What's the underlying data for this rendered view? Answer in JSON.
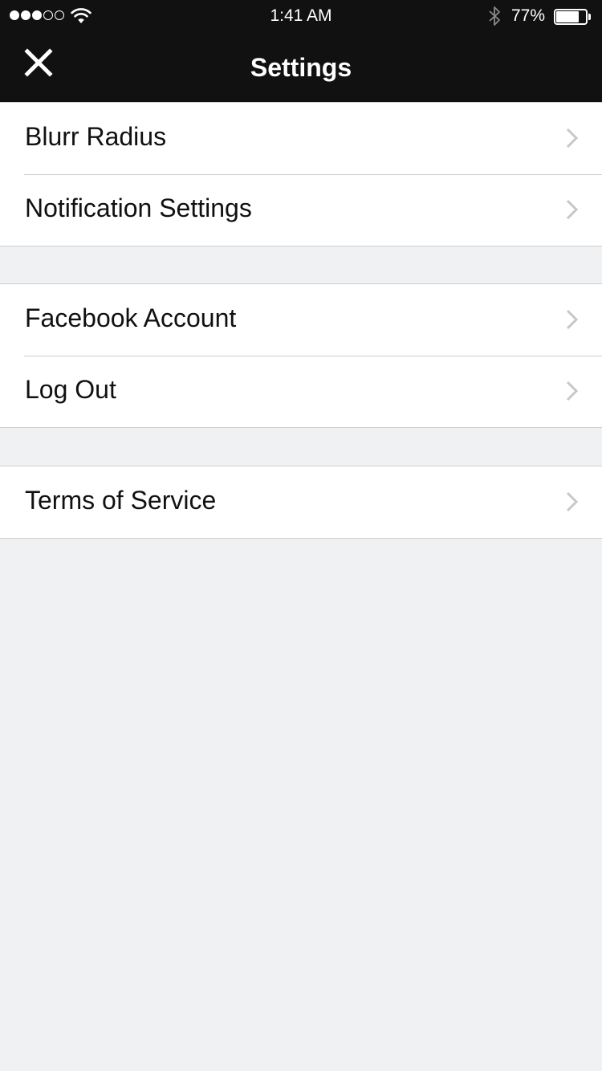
{
  "status_bar": {
    "signal_filled": 3,
    "signal_total": 5,
    "time": "1:41 AM",
    "battery_percent_label": "77%",
    "battery_level": 0.77,
    "icons": [
      "signal-dots-icon",
      "wifi-icon",
      "bluetooth-icon",
      "battery-icon"
    ]
  },
  "nav": {
    "title": "Settings",
    "close_icon": "close-icon"
  },
  "groups": [
    {
      "items": [
        {
          "label": "Blurr Radius"
        },
        {
          "label": "Notification Settings"
        }
      ]
    },
    {
      "items": [
        {
          "label": "Facebook Account"
        },
        {
          "label": "Log Out"
        }
      ]
    },
    {
      "items": [
        {
          "label": "Terms of Service"
        }
      ]
    }
  ],
  "colors": {
    "bar_background": "#111111",
    "page_background": "#f0f1f3",
    "row_background": "#ffffff",
    "separator": "#cfcfd2",
    "chevron": "#c7c7cc"
  }
}
